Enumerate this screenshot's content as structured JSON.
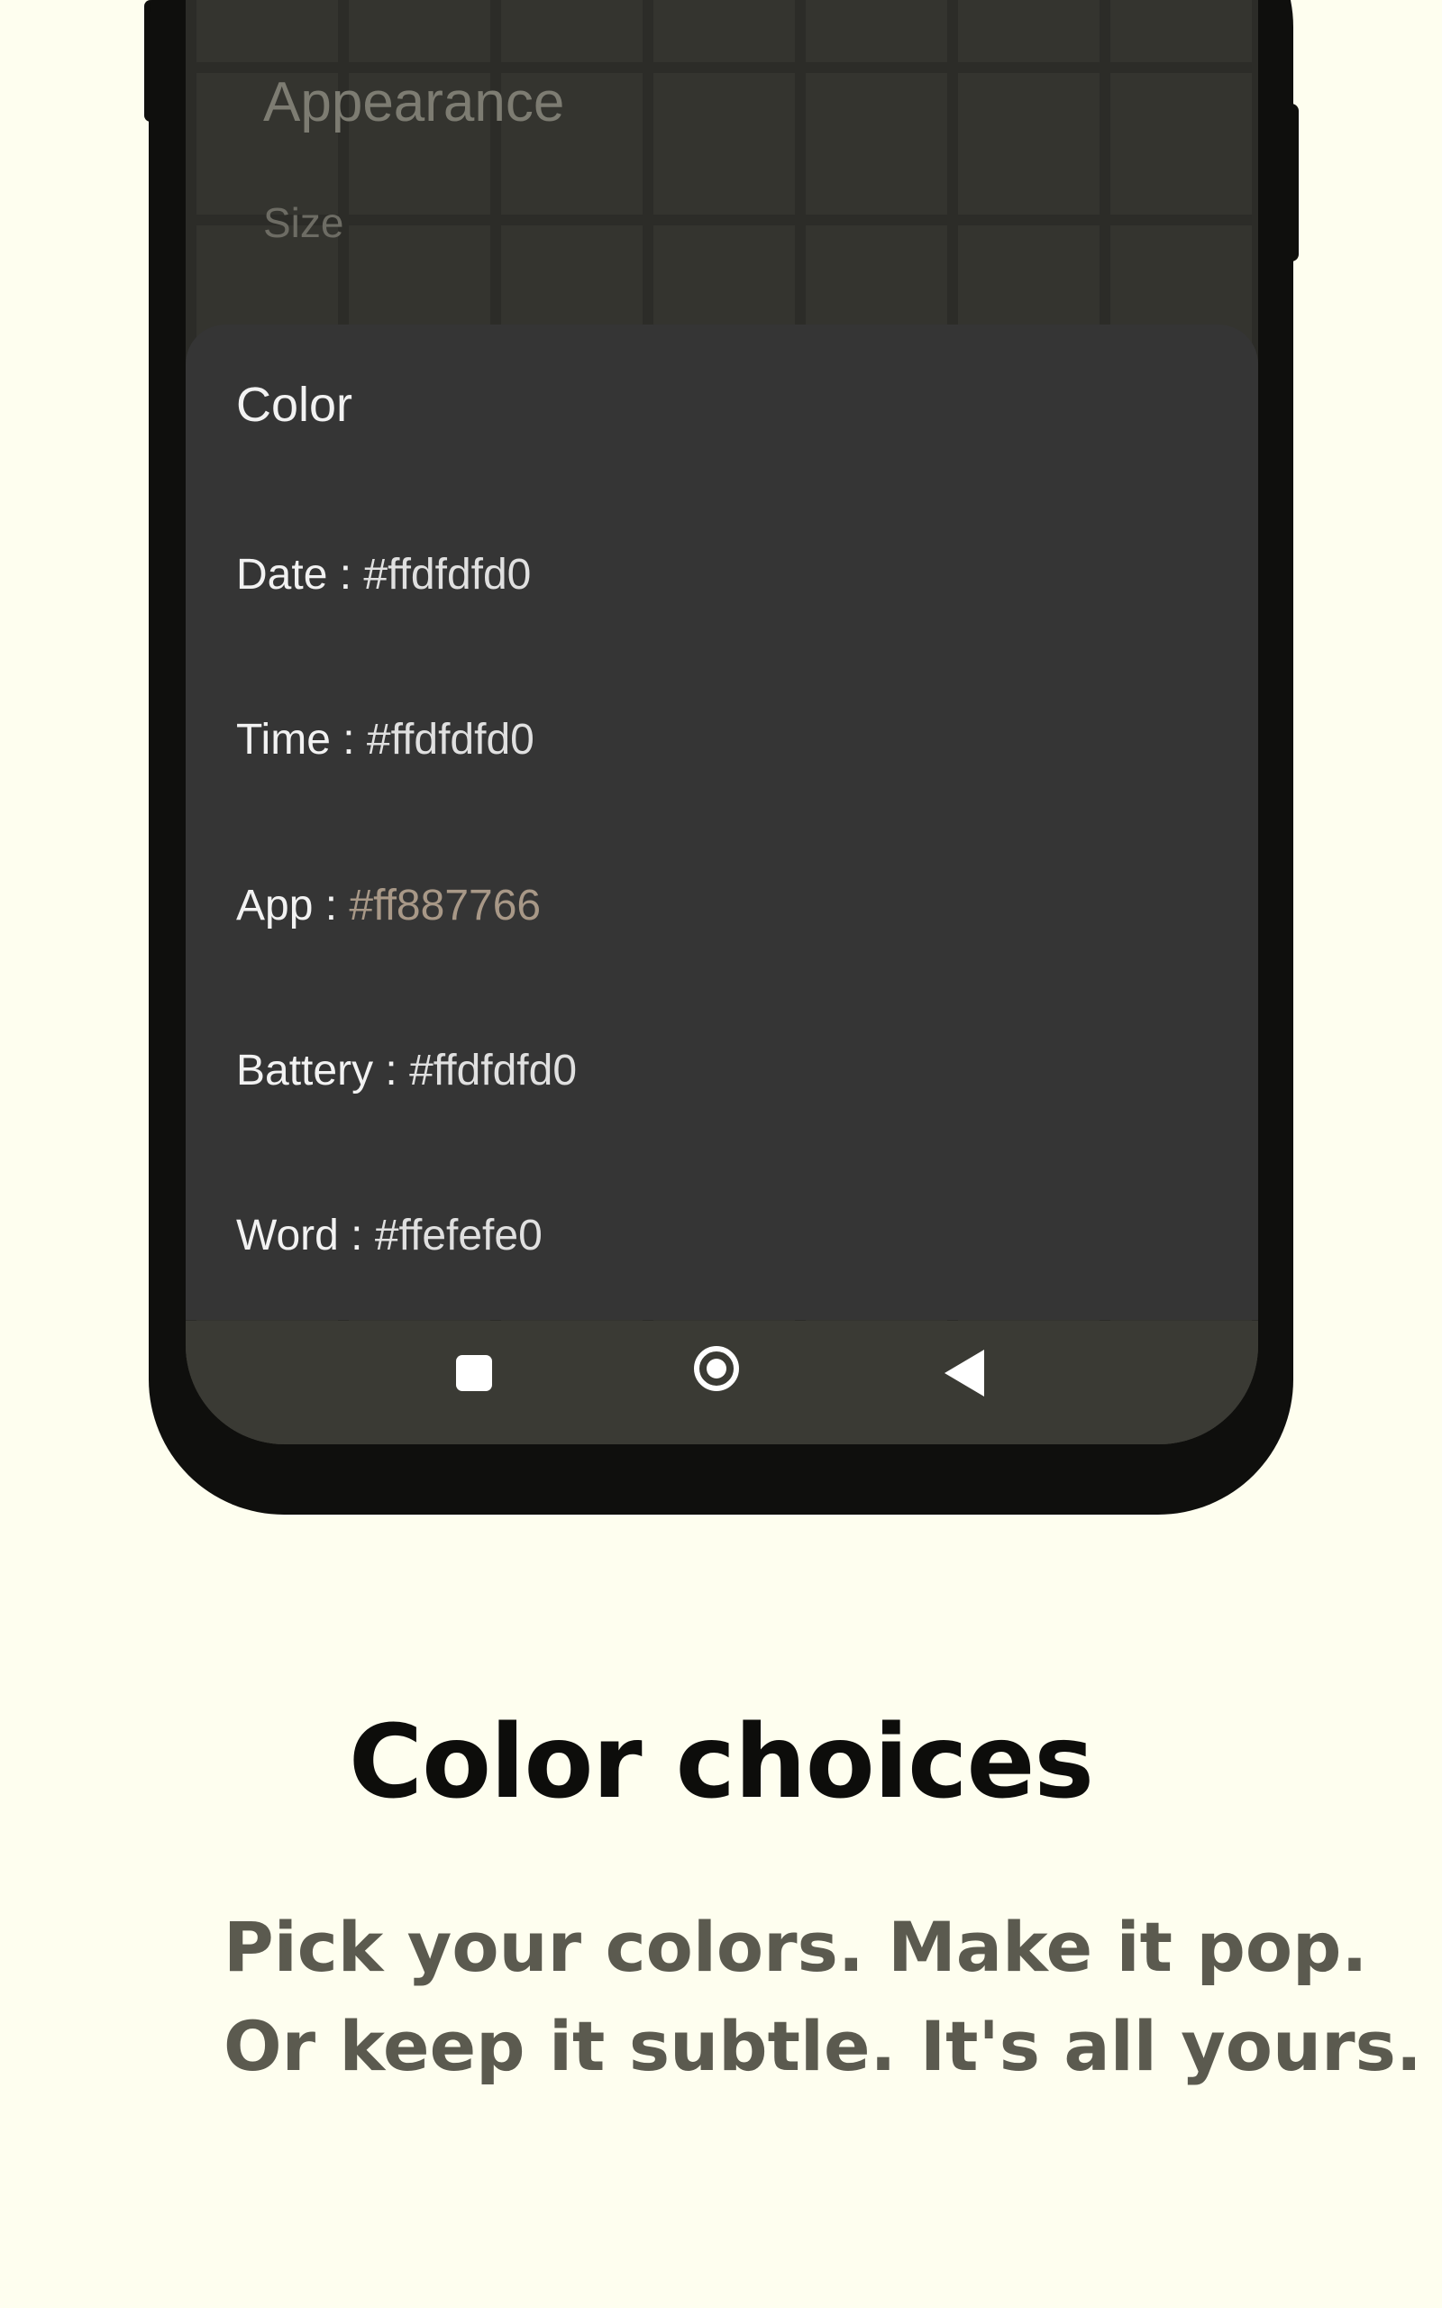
{
  "background_screen": {
    "title": "Appearance",
    "subtitle": "Size",
    "peek": ""
  },
  "dialog": {
    "title": "Color",
    "items": [
      {
        "label": "Date : ",
        "value": "#ffdfdfd0"
      },
      {
        "label": "Time : ",
        "value": "#ffdfdfd0"
      },
      {
        "label": "App : ",
        "value": "#ff887766"
      },
      {
        "label": "Battery : ",
        "value": "#ffdfdfd0"
      },
      {
        "label": "Word : ",
        "value": "#ffefefe0"
      }
    ]
  },
  "navbar": {
    "icons": [
      "recents-icon",
      "home-icon",
      "back-icon"
    ]
  },
  "marketing": {
    "headline": "Color choices",
    "line1": "Pick your colors. Make it pop.",
    "line2": "Or keep it subtle. It's all yours."
  },
  "colors": {
    "page_background": "#fefeef",
    "dialog_background": "#353535",
    "app_value_color": "#a89887"
  }
}
